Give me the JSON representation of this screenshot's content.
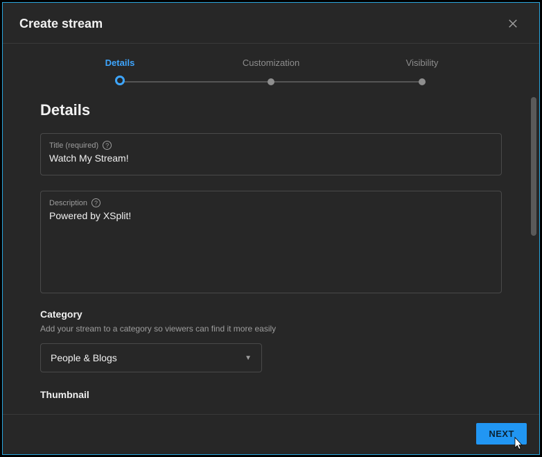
{
  "dialog": {
    "title": "Create stream"
  },
  "steps": [
    {
      "label": "Details"
    },
    {
      "label": "Customization"
    },
    {
      "label": "Visibility"
    }
  ],
  "section_heading": "Details",
  "title_field": {
    "label": "Title (required)",
    "value": "Watch My Stream!"
  },
  "description_field": {
    "label": "Description",
    "value": "Powered by XSplit!"
  },
  "category": {
    "heading": "Category",
    "hint": "Add your stream to a category so viewers can find it more easily",
    "selected": "People & Blogs"
  },
  "thumbnail": {
    "heading": "Thumbnail"
  },
  "footer": {
    "next": "NEXT"
  }
}
